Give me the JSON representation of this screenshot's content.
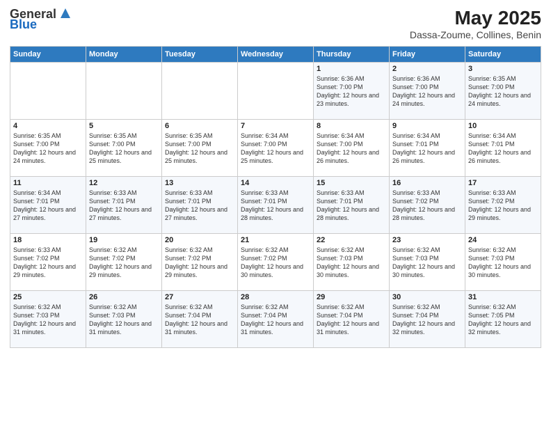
{
  "header": {
    "logo_general": "General",
    "logo_blue": "Blue",
    "month_year": "May 2025",
    "location": "Dassa-Zoume, Collines, Benin"
  },
  "weekdays": [
    "Sunday",
    "Monday",
    "Tuesday",
    "Wednesday",
    "Thursday",
    "Friday",
    "Saturday"
  ],
  "weeks": [
    [
      {
        "day": "",
        "content": ""
      },
      {
        "day": "",
        "content": ""
      },
      {
        "day": "",
        "content": ""
      },
      {
        "day": "",
        "content": ""
      },
      {
        "day": "1",
        "content": "Sunrise: 6:36 AM\nSunset: 7:00 PM\nDaylight: 12 hours and 23 minutes."
      },
      {
        "day": "2",
        "content": "Sunrise: 6:36 AM\nSunset: 7:00 PM\nDaylight: 12 hours and 24 minutes."
      },
      {
        "day": "3",
        "content": "Sunrise: 6:35 AM\nSunset: 7:00 PM\nDaylight: 12 hours and 24 minutes."
      }
    ],
    [
      {
        "day": "4",
        "content": "Sunrise: 6:35 AM\nSunset: 7:00 PM\nDaylight: 12 hours and 24 minutes."
      },
      {
        "day": "5",
        "content": "Sunrise: 6:35 AM\nSunset: 7:00 PM\nDaylight: 12 hours and 25 minutes."
      },
      {
        "day": "6",
        "content": "Sunrise: 6:35 AM\nSunset: 7:00 PM\nDaylight: 12 hours and 25 minutes."
      },
      {
        "day": "7",
        "content": "Sunrise: 6:34 AM\nSunset: 7:00 PM\nDaylight: 12 hours and 25 minutes."
      },
      {
        "day": "8",
        "content": "Sunrise: 6:34 AM\nSunset: 7:00 PM\nDaylight: 12 hours and 26 minutes."
      },
      {
        "day": "9",
        "content": "Sunrise: 6:34 AM\nSunset: 7:01 PM\nDaylight: 12 hours and 26 minutes."
      },
      {
        "day": "10",
        "content": "Sunrise: 6:34 AM\nSunset: 7:01 PM\nDaylight: 12 hours and 26 minutes."
      }
    ],
    [
      {
        "day": "11",
        "content": "Sunrise: 6:34 AM\nSunset: 7:01 PM\nDaylight: 12 hours and 27 minutes."
      },
      {
        "day": "12",
        "content": "Sunrise: 6:33 AM\nSunset: 7:01 PM\nDaylight: 12 hours and 27 minutes."
      },
      {
        "day": "13",
        "content": "Sunrise: 6:33 AM\nSunset: 7:01 PM\nDaylight: 12 hours and 27 minutes."
      },
      {
        "day": "14",
        "content": "Sunrise: 6:33 AM\nSunset: 7:01 PM\nDaylight: 12 hours and 28 minutes."
      },
      {
        "day": "15",
        "content": "Sunrise: 6:33 AM\nSunset: 7:01 PM\nDaylight: 12 hours and 28 minutes."
      },
      {
        "day": "16",
        "content": "Sunrise: 6:33 AM\nSunset: 7:02 PM\nDaylight: 12 hours and 28 minutes."
      },
      {
        "day": "17",
        "content": "Sunrise: 6:33 AM\nSunset: 7:02 PM\nDaylight: 12 hours and 29 minutes."
      }
    ],
    [
      {
        "day": "18",
        "content": "Sunrise: 6:33 AM\nSunset: 7:02 PM\nDaylight: 12 hours and 29 minutes."
      },
      {
        "day": "19",
        "content": "Sunrise: 6:32 AM\nSunset: 7:02 PM\nDaylight: 12 hours and 29 minutes."
      },
      {
        "day": "20",
        "content": "Sunrise: 6:32 AM\nSunset: 7:02 PM\nDaylight: 12 hours and 29 minutes."
      },
      {
        "day": "21",
        "content": "Sunrise: 6:32 AM\nSunset: 7:02 PM\nDaylight: 12 hours and 30 minutes."
      },
      {
        "day": "22",
        "content": "Sunrise: 6:32 AM\nSunset: 7:03 PM\nDaylight: 12 hours and 30 minutes."
      },
      {
        "day": "23",
        "content": "Sunrise: 6:32 AM\nSunset: 7:03 PM\nDaylight: 12 hours and 30 minutes."
      },
      {
        "day": "24",
        "content": "Sunrise: 6:32 AM\nSunset: 7:03 PM\nDaylight: 12 hours and 30 minutes."
      }
    ],
    [
      {
        "day": "25",
        "content": "Sunrise: 6:32 AM\nSunset: 7:03 PM\nDaylight: 12 hours and 31 minutes."
      },
      {
        "day": "26",
        "content": "Sunrise: 6:32 AM\nSunset: 7:03 PM\nDaylight: 12 hours and 31 minutes."
      },
      {
        "day": "27",
        "content": "Sunrise: 6:32 AM\nSunset: 7:04 PM\nDaylight: 12 hours and 31 minutes."
      },
      {
        "day": "28",
        "content": "Sunrise: 6:32 AM\nSunset: 7:04 PM\nDaylight: 12 hours and 31 minutes."
      },
      {
        "day": "29",
        "content": "Sunrise: 6:32 AM\nSunset: 7:04 PM\nDaylight: 12 hours and 31 minutes."
      },
      {
        "day": "30",
        "content": "Sunrise: 6:32 AM\nSunset: 7:04 PM\nDaylight: 12 hours and 32 minutes."
      },
      {
        "day": "31",
        "content": "Sunrise: 6:32 AM\nSunset: 7:05 PM\nDaylight: 12 hours and 32 minutes."
      }
    ]
  ]
}
